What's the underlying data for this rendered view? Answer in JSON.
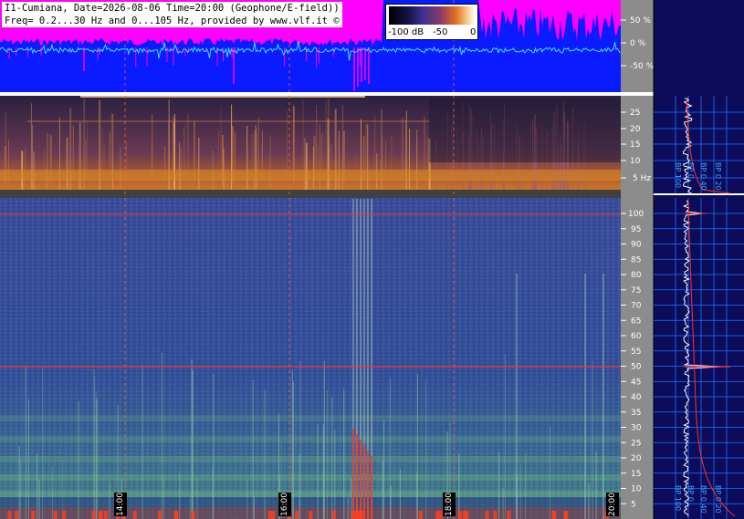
{
  "header": {
    "line1": "I1-Cumiana, Date=2026-08-06 Time=20:00 (Geophone/E-field))",
    "line2": "Freq= 0.2...30 Hz and 0...105 Hz, provided by www.vlf.it ©"
  },
  "colorbar": {
    "min_label": "-100 dB",
    "mid_label": "-50",
    "max_label": "0"
  },
  "amplitude_axis": [
    "50 %",
    "0 %",
    "-50 %"
  ],
  "upper_freq_axis": [
    "25",
    "20",
    "15",
    "10",
    "5 Hz"
  ],
  "lower_freq_axis": [
    "100",
    "95",
    "90",
    "85",
    "80",
    "75",
    "70",
    "65",
    "60",
    "55",
    "50",
    "45",
    "40",
    "35",
    "30",
    "25",
    "20",
    "15",
    "10",
    "5"
  ],
  "time_labels": [
    "14:00",
    "16:00",
    "18:00",
    "20:00"
  ],
  "bp_upper_labels": [
    "BP 100",
    "BP 0",
    "BP 0 40",
    "BP 0 20"
  ],
  "bp_lower_labels": [
    "BP 100",
    "BP 0",
    "BP 0 40",
    "BP 0 20"
  ],
  "colors": {
    "waveform_bg": "#0a1cff",
    "magenta": "#ff00ff",
    "axis_bg": "#8c8c8c",
    "side_bg": "#0c0c5a",
    "grid_blue": "#1e74ff",
    "spectrogram_low": "#2a3a8c",
    "spectrogram_high": "#e8f0c0",
    "hum_line": "#ff2020"
  }
}
